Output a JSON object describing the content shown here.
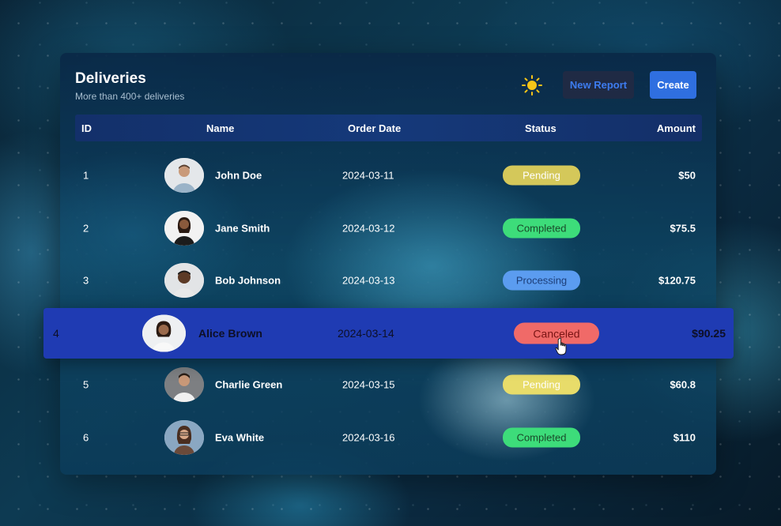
{
  "header": {
    "title": "Deliveries",
    "subtitle": "More than 400+ deliveries",
    "theme_icon": "sun-icon",
    "new_report_label": "New Report",
    "create_label": "Create"
  },
  "table": {
    "columns": [
      "ID",
      "Name",
      "Order Date",
      "Status",
      "Amount"
    ],
    "rows": [
      {
        "id": "1",
        "name": "John Doe",
        "date": "2024-03-11",
        "status": "Pending",
        "amount": "$50"
      },
      {
        "id": "2",
        "name": "Jane Smith",
        "date": "2024-03-12",
        "status": "Completed",
        "amount": "$75.5"
      },
      {
        "id": "3",
        "name": "Bob Johnson",
        "date": "2024-03-13",
        "status": "Processing",
        "amount": "$120.75"
      },
      {
        "id": "4",
        "name": "Alice Brown",
        "date": "2024-03-14",
        "status": "Canceled",
        "amount": "$90.25"
      },
      {
        "id": "5",
        "name": "Charlie Green",
        "date": "2024-03-15",
        "status": "Pending",
        "amount": "$60.8"
      },
      {
        "id": "6",
        "name": "Eva White",
        "date": "2024-03-16",
        "status": "Completed",
        "amount": "$110"
      }
    ]
  },
  "colors": {
    "pending": "#d4c85a",
    "completed": "#3ddc7a",
    "processing": "#5b9cf0",
    "canceled": "#f06a68",
    "highlight_row": "#1f3bb3",
    "accent": "#2f6fe0"
  }
}
